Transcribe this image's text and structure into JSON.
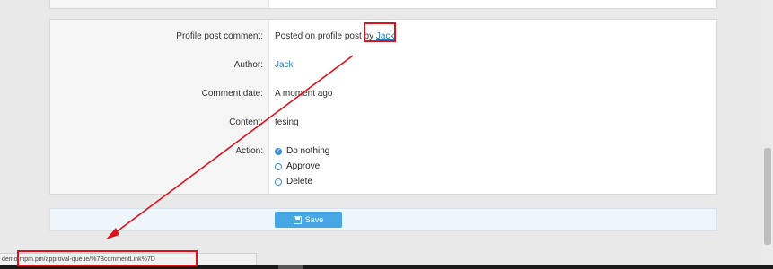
{
  "form": {
    "profile_post_comment": {
      "label": "Profile post comment:",
      "prefix": "Posted on profile post by ",
      "link": "Jack"
    },
    "author": {
      "label": "Author:",
      "value": "Jack"
    },
    "comment_date": {
      "label": "Comment date:",
      "value": "A moment ago"
    },
    "content": {
      "label": "Content:",
      "value": "tesing"
    },
    "action": {
      "label": "Action:",
      "options": [
        "Do nothing",
        "Approve",
        "Delete"
      ],
      "selected": "Do nothing"
    }
  },
  "footer": {
    "save_label": "Save"
  },
  "status_bar": {
    "url": "demo.mpm.pm/approval-queue/%7BcommentLink%7D"
  },
  "colors": {
    "highlight": "#e0101a",
    "accent": "#47a6e6",
    "link": "#2f7fbf"
  },
  "icons": {
    "save": "floppy-disk-icon",
    "radio_checked": "check-circle-icon"
  }
}
